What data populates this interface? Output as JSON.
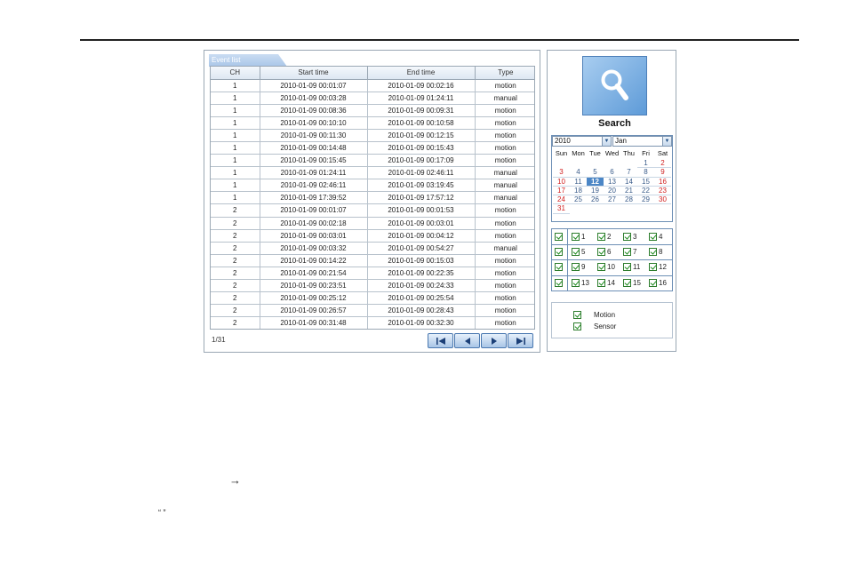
{
  "event_list": {
    "tab_label": "Event list",
    "columns": [
      "CH",
      "Start time",
      "End time",
      "Type"
    ],
    "rows": [
      [
        "1",
        "2010-01-09 00:01:07",
        "2010-01-09 00:02:16",
        "motion"
      ],
      [
        "1",
        "2010-01-09 00:03:28",
        "2010-01-09 01:24:11",
        "manual"
      ],
      [
        "1",
        "2010-01-09 00:08:36",
        "2010-01-09 00:09:31",
        "motion"
      ],
      [
        "1",
        "2010-01-09 00:10:10",
        "2010-01-09 00:10:58",
        "motion"
      ],
      [
        "1",
        "2010-01-09 00:11:30",
        "2010-01-09 00:12:15",
        "motion"
      ],
      [
        "1",
        "2010-01-09 00:14:48",
        "2010-01-09 00:15:43",
        "motion"
      ],
      [
        "1",
        "2010-01-09 00:15:45",
        "2010-01-09 00:17:09",
        "motion"
      ],
      [
        "1",
        "2010-01-09 01:24:11",
        "2010-01-09 02:46:11",
        "manual"
      ],
      [
        "1",
        "2010-01-09 02:46:11",
        "2010-01-09 03:19:45",
        "manual"
      ],
      [
        "1",
        "2010-01-09 17:39:52",
        "2010-01-09 17:57:12",
        "manual"
      ],
      [
        "2",
        "2010-01-09 00:01:07",
        "2010-01-09 00:01:53",
        "motion"
      ],
      [
        "2",
        "2010-01-09 00:02:18",
        "2010-01-09 00:03:01",
        "motion"
      ],
      [
        "2",
        "2010-01-09 00:03:01",
        "2010-01-09 00:04:12",
        "motion"
      ],
      [
        "2",
        "2010-01-09 00:03:32",
        "2010-01-09 00:54:27",
        "manual"
      ],
      [
        "2",
        "2010-01-09 00:14:22",
        "2010-01-09 00:15:03",
        "motion"
      ],
      [
        "2",
        "2010-01-09 00:21:54",
        "2010-01-09 00:22:35",
        "motion"
      ],
      [
        "2",
        "2010-01-09 00:23:51",
        "2010-01-09 00:24:33",
        "motion"
      ],
      [
        "2",
        "2010-01-09 00:25:12",
        "2010-01-09 00:25:54",
        "motion"
      ],
      [
        "2",
        "2010-01-09 00:26:57",
        "2010-01-09 00:28:43",
        "motion"
      ],
      [
        "2",
        "2010-01-09 00:31:48",
        "2010-01-09 00:32:30",
        "motion"
      ]
    ],
    "page_info": "1/31",
    "nav_icons": [
      "first-page-icon",
      "prev-page-icon",
      "next-page-icon",
      "last-page-icon"
    ]
  },
  "search": {
    "button_label": "Search",
    "icon": "magnifier-icon",
    "year": "2010",
    "month": "Jan",
    "weekdays": [
      "Sun",
      "Mon",
      "Tue",
      "Wed",
      "Thu",
      "Fri",
      "Sat"
    ],
    "calendar_weeks": [
      [
        "",
        "",
        "",
        "",
        "",
        "1",
        "2"
      ],
      [
        "3",
        "4",
        "5",
        "6",
        "7",
        "8",
        "9"
      ],
      [
        "10",
        "11",
        "12",
        "13",
        "14",
        "15",
        "16"
      ],
      [
        "17",
        "18",
        "19",
        "20",
        "21",
        "22",
        "23"
      ],
      [
        "24",
        "25",
        "26",
        "27",
        "28",
        "29",
        "30"
      ],
      [
        "31",
        "",
        "",
        "",
        "",
        "",
        ""
      ]
    ],
    "selected_day": "12",
    "channel_rows": [
      [
        "1",
        "2",
        "3",
        "4"
      ],
      [
        "5",
        "6",
        "7",
        "8"
      ],
      [
        "9",
        "10",
        "11",
        "12"
      ],
      [
        "13",
        "14",
        "15",
        "16"
      ]
    ],
    "event_types": [
      "Motion",
      "Sensor"
    ]
  },
  "page_text": {
    "arrow": "→",
    "quotes": "“         ”"
  },
  "colors": {
    "accent_blue": "#4b86c6",
    "weekend_red": "#d02020",
    "check_green": "#1d8a1d"
  }
}
